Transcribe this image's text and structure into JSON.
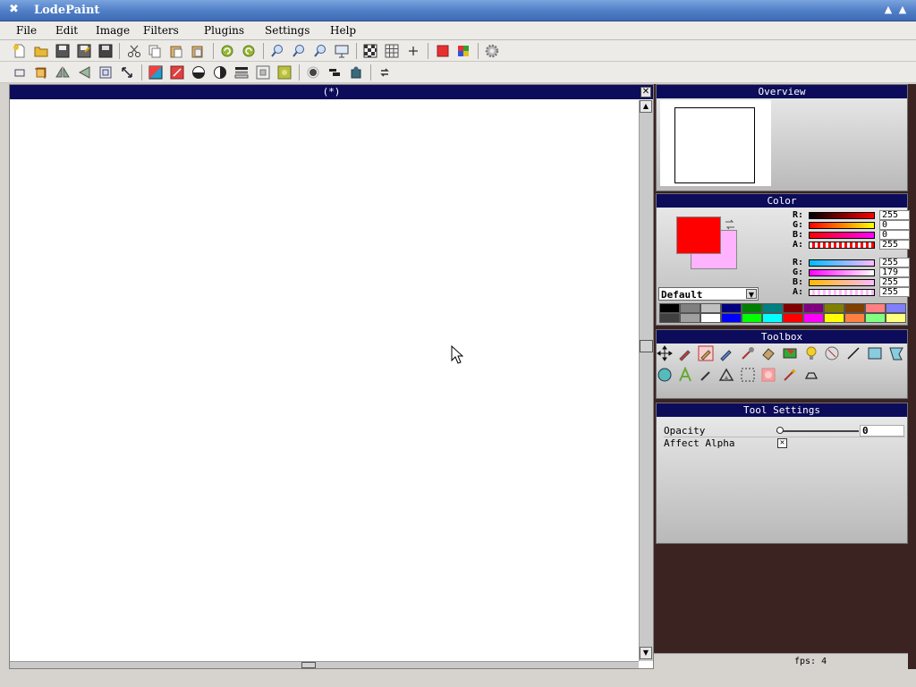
{
  "window": {
    "title": "LodePaint"
  },
  "menubar": {
    "items": [
      "File",
      "Edit",
      "Image",
      "Filters",
      "Plugins",
      "Settings",
      "Help"
    ]
  },
  "canvas": {
    "title": "(*)"
  },
  "panels": {
    "overview": {
      "title": "Overview"
    },
    "color": {
      "title": "Color",
      "primary_color": "#ff0000",
      "secondary_color": "#ffb3ff",
      "primary": {
        "labels": [
          "R:",
          "G:",
          "B:",
          "A:"
        ],
        "values": [
          "255",
          "0",
          "0",
          "255"
        ]
      },
      "secondary": {
        "labels": [
          "R:",
          "G:",
          "B:",
          "A:"
        ],
        "values": [
          "255",
          "179",
          "255",
          "255"
        ]
      },
      "palette_select": "Default",
      "palette": [
        "#000000",
        "#808080",
        "#c0c0c0",
        "#000080",
        "#008000",
        "#008080",
        "#800000",
        "#800080",
        "#808000",
        "#804000",
        "#ff8080",
        "#8080ff",
        "#404040",
        "#a0a0a0",
        "#ffffff",
        "#0000ff",
        "#00ff00",
        "#00ffff",
        "#ff0000",
        "#ff00ff",
        "#ffff00",
        "#ff8040",
        "#80ff80",
        "#ffff80"
      ]
    },
    "toolbox": {
      "title": "Toolbox"
    },
    "tool_settings": {
      "title": "Tool Settings",
      "opacity_label": "Opacity",
      "opacity_value": "0",
      "affect_alpha_label": "Affect Alpha",
      "affect_alpha_mark": "✕"
    }
  },
  "status": {
    "fps": "fps: 4"
  }
}
